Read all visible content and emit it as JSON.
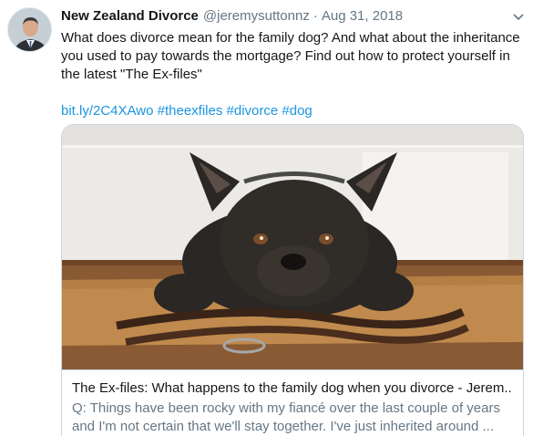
{
  "tweet": {
    "display_name": "New Zealand Divorce",
    "handle": "@jeremysuttonnz",
    "separator": "·",
    "timestamp": "Aug 31, 2018",
    "text_line1": "What does divorce mean for the family dog? And what about the inheritance",
    "text_line2": "you used to pay towards the mortgage? Find out how to protect yourself in",
    "text_line3": "the latest \"The Ex-files\"",
    "link_short": "bit.ly/2C4XAwo",
    "hashtags": [
      "#theexfiles",
      "#divorce",
      "#dog"
    ]
  },
  "card": {
    "title": "The Ex-files: What happens to the family dog when you divorce - Jerem...",
    "description_line1": "Q: Things have been rocky with my fiancé over the last couple of years",
    "description_line2": "and I'm not certain that we'll stay together. I've just inherited around ..."
  },
  "icons": {
    "avatar": "profile-photo",
    "caret": "chevron-down-icon"
  },
  "colors": {
    "link": "#1b95e0",
    "secondary_text": "#657786",
    "border": "#ccd6dd"
  }
}
